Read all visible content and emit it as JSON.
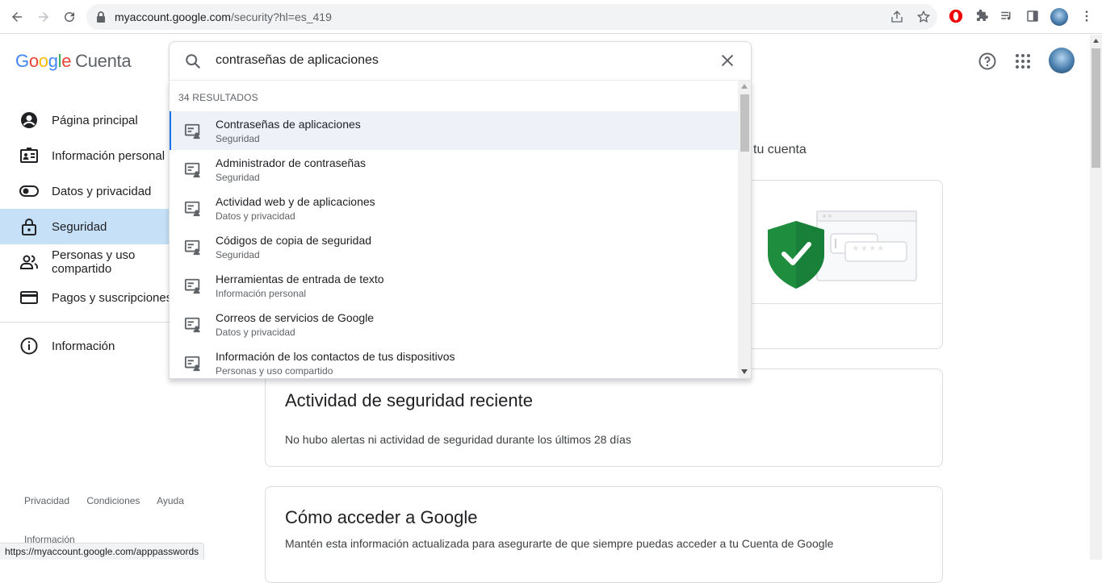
{
  "browser": {
    "url_domain": "myaccount.google.com",
    "url_path": "/security?hl=es_419",
    "status_url": "https://myaccount.google.com/apppasswords"
  },
  "header": {
    "logo_letters": [
      "G",
      "o",
      "o",
      "g",
      "l",
      "e"
    ],
    "product": "Cuenta"
  },
  "sidebar": {
    "items": [
      {
        "label": "Página principal",
        "icon": "account-circle-icon"
      },
      {
        "label": "Información personal",
        "icon": "id-card-icon"
      },
      {
        "label": "Datos y privacidad",
        "icon": "toggle-icon"
      },
      {
        "label": "Seguridad",
        "icon": "lock-icon"
      },
      {
        "label": "Personas y uso compartido",
        "icon": "people-icon"
      },
      {
        "label": "Pagos y suscripciones",
        "icon": "credit-card-icon"
      }
    ],
    "info": {
      "label": "Información",
      "icon": "info-icon"
    }
  },
  "footer": {
    "links": [
      "Privacidad",
      "Condiciones",
      "Ayuda"
    ],
    "info": "Información"
  },
  "search": {
    "value": "contraseñas de aplicaciones",
    "results_count": "34 RESULTADOS",
    "results": [
      {
        "title": "Contraseñas de aplicaciones",
        "section": "Seguridad"
      },
      {
        "title": "Administrador de contraseñas",
        "section": "Seguridad"
      },
      {
        "title": "Actividad web y de aplicaciones",
        "section": "Datos y privacidad"
      },
      {
        "title": "Códigos de copia de seguridad",
        "section": "Seguridad"
      },
      {
        "title": "Herramientas de entrada de texto",
        "section": "Información personal"
      },
      {
        "title": "Correos de servicios de Google",
        "section": "Datos y privacidad"
      },
      {
        "title": "Información de los contactos de tus dispositivos",
        "section": "Personas y uso compartido"
      }
    ]
  },
  "main": {
    "partial_text": "tu cuenta",
    "security_card": {
      "password_mask": "****"
    },
    "activity_card": {
      "title": "Actividad de seguridad reciente",
      "text": "No hubo alertas ni actividad de seguridad durante los últimos 28 días"
    },
    "access_card": {
      "title": "Cómo acceder a Google",
      "text": "Mantén esta información actualizada para asegurarte de que siempre puedas acceder a tu Cuenta de Google"
    }
  },
  "colors": {
    "accent": "#1a73e8",
    "shield": "#1e8e3e",
    "active_nav": "#c6e0f8"
  }
}
